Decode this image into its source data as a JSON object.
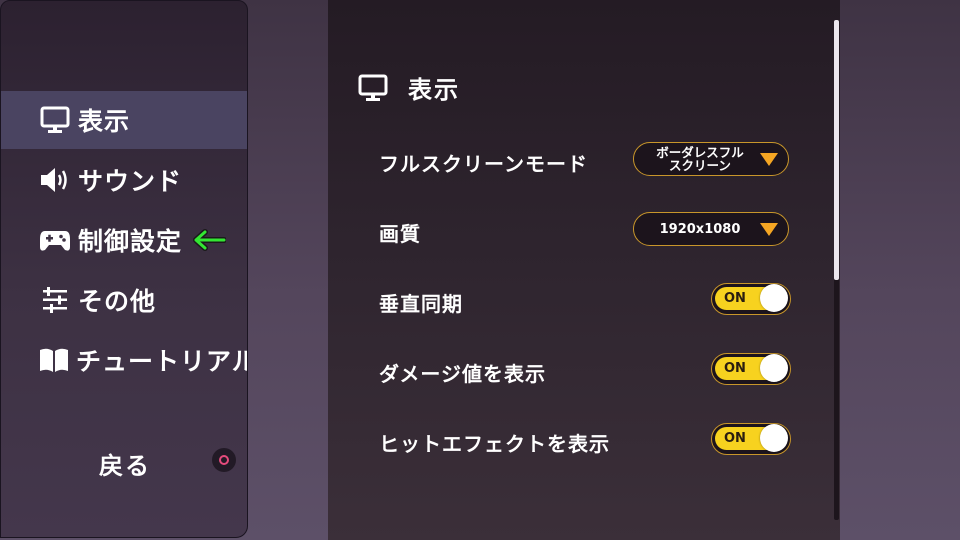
{
  "sidebar": {
    "items": [
      {
        "label": "表示",
        "icon": "monitor-icon",
        "selected": true
      },
      {
        "label": "サウンド",
        "icon": "speaker-icon",
        "selected": false
      },
      {
        "label": "制御設定",
        "icon": "gamepad-icon",
        "selected": false
      },
      {
        "label": "その他",
        "icon": "sliders-icon",
        "selected": false
      },
      {
        "label": "チュートリアル",
        "icon": "book-icon",
        "selected": false
      }
    ],
    "annotation_arrow": "green-arrow-icon",
    "back_label": "戻る",
    "back_glyph": "circle-button-icon"
  },
  "main": {
    "section_title": "表示",
    "section_icon": "monitor-icon",
    "settings": [
      {
        "label": "フルスクリーンモード",
        "type": "dropdown",
        "value_line1": "ボーダレスフル",
        "value_line2": "スクリーン"
      },
      {
        "label": "画質",
        "type": "dropdown",
        "value": "1920x1080"
      },
      {
        "label": "垂直同期",
        "type": "toggle",
        "value": "ON"
      },
      {
        "label": "ダメージ値を表示",
        "type": "toggle",
        "value": "ON"
      },
      {
        "label": "ヒットエフェクトを表示",
        "type": "toggle",
        "value": "ON"
      }
    ],
    "scroll_fraction_visible": 0.52
  },
  "colors": {
    "accent_yellow": "#f7d21f",
    "dropdown_arrow": "#f5a623",
    "border_gold": "#c8962a",
    "selected_item_bg": "#4a4461",
    "annotation_green": "#33e633",
    "circle_button": "#e54b7c"
  }
}
